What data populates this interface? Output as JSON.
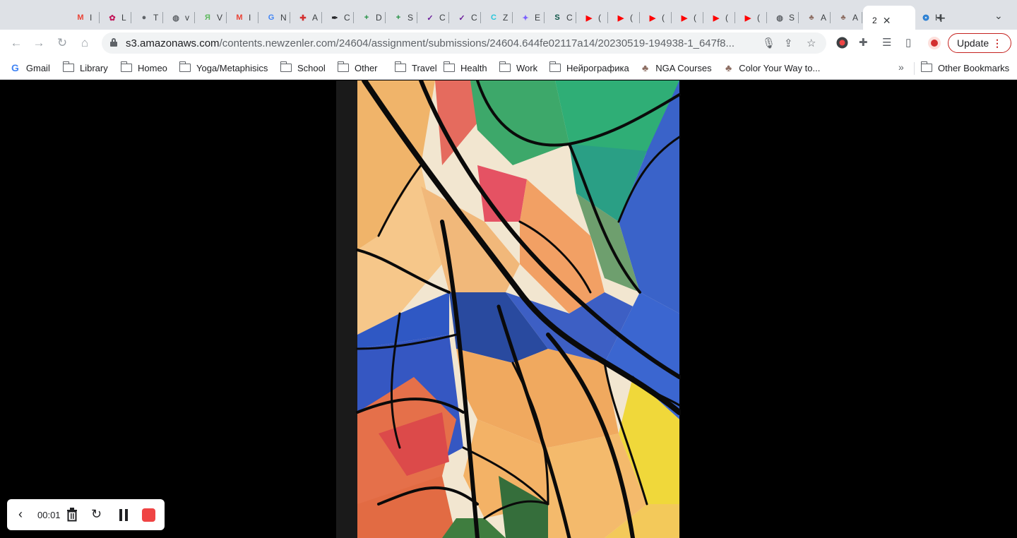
{
  "tabs": [
    {
      "title": "I",
      "icon": "gmail-icon",
      "color": "#ea4335",
      "glyph": "M"
    },
    {
      "title": "L",
      "icon": "lotus-icon",
      "color": "#c2185b",
      "glyph": "✿"
    },
    {
      "title": "T",
      "icon": "circle-icon",
      "color": "#5f6368",
      "glyph": "●"
    },
    {
      "title": "v",
      "icon": "globe-icon",
      "color": "#5f6368",
      "glyph": "◍"
    },
    {
      "title": "V",
      "icon": "translate-icon",
      "color": "#5cb85c",
      "glyph": "Я"
    },
    {
      "title": "I",
      "icon": "gmail-icon",
      "color": "#ea4335",
      "glyph": "M"
    },
    {
      "title": "N",
      "icon": "google-icon",
      "color": "#4285f4",
      "glyph": "G"
    },
    {
      "title": "A",
      "icon": "redcross-icon",
      "color": "#d32f2f",
      "glyph": "✚"
    },
    {
      "title": "C",
      "icon": "pen-nib-icon",
      "color": "#202124",
      "glyph": "✒"
    },
    {
      "title": "D",
      "icon": "green-plus-icon",
      "color": "#1e8e3e",
      "glyph": "+"
    },
    {
      "title": "S",
      "icon": "green-plus-icon",
      "color": "#1e8e3e",
      "glyph": "+"
    },
    {
      "title": "C",
      "icon": "purple-check-icon",
      "color": "#6a1b9a",
      "glyph": "✓"
    },
    {
      "title": "C",
      "icon": "purple-check-icon",
      "color": "#6a1b9a",
      "glyph": "✓"
    },
    {
      "title": "Z",
      "icon": "c-icon",
      "color": "#26c6da",
      "glyph": "C"
    },
    {
      "title": "E",
      "icon": "sparkle-icon",
      "color": "#7b61ff",
      "glyph": "✦"
    },
    {
      "title": "C",
      "icon": "s-icon",
      "color": "#0b5345",
      "glyph": "S"
    },
    {
      "title": "(",
      "icon": "youtube-icon",
      "color": "#ff0000",
      "glyph": "▶"
    },
    {
      "title": "(",
      "icon": "youtube-icon",
      "color": "#ff0000",
      "glyph": "▶"
    },
    {
      "title": "(",
      "icon": "youtube-icon",
      "color": "#ff0000",
      "glyph": "▶"
    },
    {
      "title": "(",
      "icon": "youtube-icon",
      "color": "#ff0000",
      "glyph": "▶"
    },
    {
      "title": "(",
      "icon": "youtube-icon",
      "color": "#ff0000",
      "glyph": "▶"
    },
    {
      "title": "(",
      "icon": "youtube-icon",
      "color": "#ff0000",
      "glyph": "▶"
    },
    {
      "title": "S",
      "icon": "globe-icon",
      "color": "#5f6368",
      "glyph": "◍"
    },
    {
      "title": "A",
      "icon": "nga-icon",
      "color": "#8d6e63",
      "glyph": "♣"
    },
    {
      "title": "A",
      "icon": "nga-icon",
      "color": "#8d6e63",
      "glyph": "♣"
    }
  ],
  "active_tab": {
    "title": "2",
    "close": "✕"
  },
  "trailing_tab": {
    "title": "H",
    "icon": "mandala-icon",
    "color": "#1976d2",
    "glyph": "❂"
  },
  "new_tab_glyph": "+",
  "tab_list_glyph": "⌄",
  "address": {
    "host": "s3.amazonaws.com",
    "path": "/contents.newzenler.com/24604/assignment/submissions/24604.644fe02117a14/20230519-194938-1_647f8..."
  },
  "toolbar": {
    "update_label": "Update",
    "menu_glyph": "⋮"
  },
  "bookmarks": [
    {
      "label": "Gmail",
      "type": "google"
    },
    {
      "label": "Library",
      "type": "folder"
    },
    {
      "label": "Homeo",
      "type": "folder"
    },
    {
      "label": "Yoga/Metaphisics",
      "type": "folder"
    },
    {
      "label": "School",
      "type": "folder"
    },
    {
      "label": "Other",
      "type": "folder"
    },
    {
      "label": "Travel",
      "type": "folder"
    },
    {
      "label": "Health",
      "type": "folder"
    },
    {
      "label": "Work",
      "type": "folder"
    },
    {
      "label": "Нейрографика",
      "type": "folder"
    },
    {
      "label": "NGA Courses",
      "type": "page"
    },
    {
      "label": "Color Your Way to...",
      "type": "page"
    }
  ],
  "bookmarks_more_glyph": "»",
  "other_bookmarks": "Other Bookmarks",
  "recorder": {
    "time": "00:01"
  }
}
